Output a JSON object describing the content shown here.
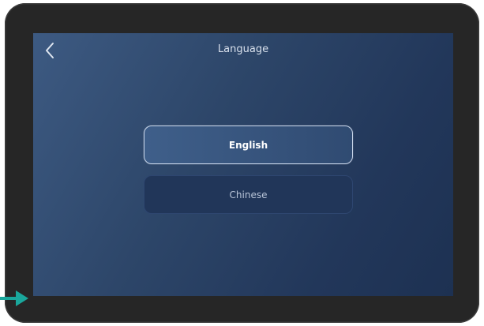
{
  "header": {
    "title": "Language",
    "back_icon": "chevron-left-icon"
  },
  "languages": [
    {
      "label": "English",
      "selected": true
    },
    {
      "label": "Chinese",
      "selected": false
    }
  ],
  "annotation": {
    "arrow_icon": "arrow-right-icon",
    "arrow_color": "#1aa79c"
  },
  "colors": {
    "bezel": "#262626",
    "screen_bg": "#2d4669",
    "selected_border": "#c9d6ea",
    "title_text": "#d8e0ec"
  }
}
